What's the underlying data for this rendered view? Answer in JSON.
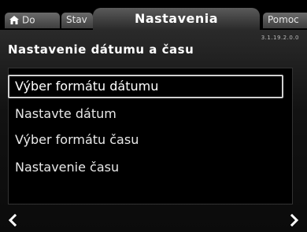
{
  "tabs": {
    "home_label": "Do",
    "stav_label": "Stav",
    "active_label": "Nastavenia",
    "help_label": "Pomoc"
  },
  "header": {
    "version": "3.1.19.2.0.0",
    "title": "Nastavenie dátumu a času"
  },
  "menu": {
    "items": [
      {
        "label": "Výber formátu dátumu",
        "selected": true
      },
      {
        "label": "Nastavte dátum",
        "selected": false
      },
      {
        "label": "Výber formátu času",
        "selected": false
      },
      {
        "label": "Nastavenie času",
        "selected": false
      }
    ]
  },
  "icons": {
    "home": "home-icon",
    "back": "chevron-left-icon",
    "forward": "chevron-right-icon"
  },
  "colors": {
    "background": "#000000",
    "text": "#e8e8e8",
    "selection_border": "#d0d0d0"
  }
}
